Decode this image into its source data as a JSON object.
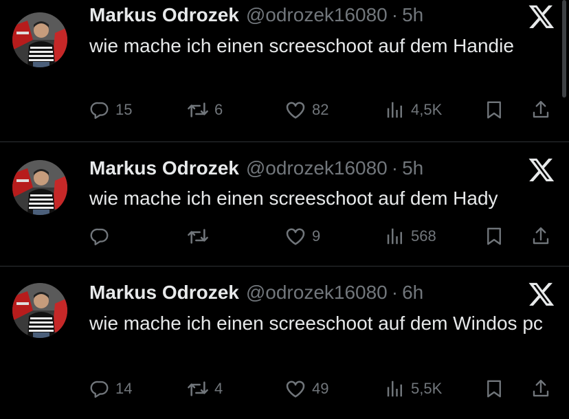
{
  "tweets": [
    {
      "author": "Markus Odrozek",
      "handle": "@odrozek16080",
      "separator": "·",
      "time": "5h",
      "text": "wie mache ich einen screeschoot auf dem Handie",
      "replies": "15",
      "retweets": "6",
      "likes": "82",
      "views": "4,5K"
    },
    {
      "author": "Markus Odrozek",
      "handle": "@odrozek16080",
      "separator": "·",
      "time": "5h",
      "text": "wie mache ich einen screeschoot auf dem Hady",
      "replies": "",
      "retweets": "",
      "likes": "9",
      "views": "568"
    },
    {
      "author": "Markus Odrozek",
      "handle": "@odrozek16080",
      "separator": "·",
      "time": "6h",
      "text": "wie mache ich einen screeschoot auf dem Windos pc",
      "replies": "14",
      "retweets": "4",
      "likes": "49",
      "views": "5,5K"
    }
  ],
  "colors": {
    "background": "#000000",
    "text": "#e7e9ea",
    "muted": "#71767b",
    "divider": "#2f3336"
  },
  "icons": [
    "x-logo-icon",
    "reply-icon",
    "retweet-icon",
    "like-icon",
    "views-icon",
    "bookmark-icon",
    "share-icon"
  ]
}
